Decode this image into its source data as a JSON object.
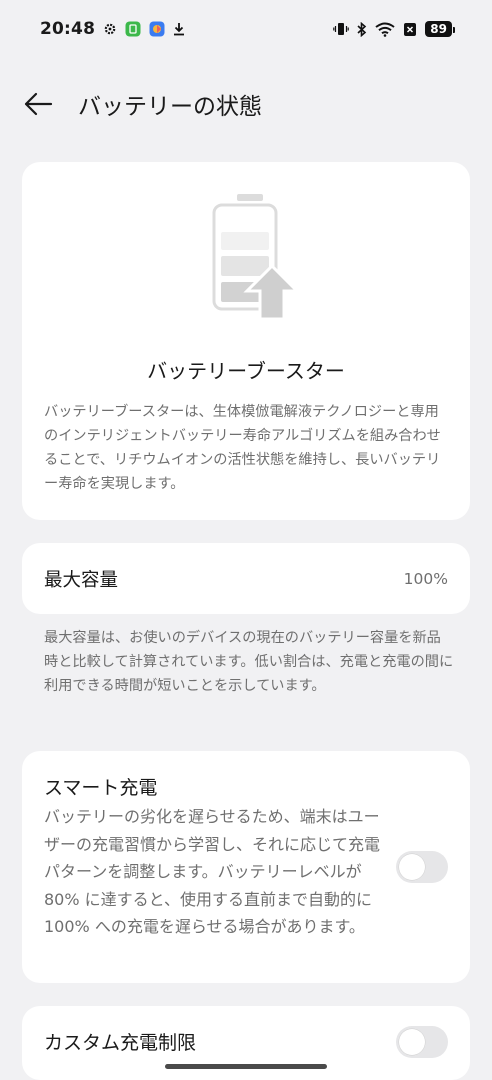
{
  "status_bar": {
    "time": "20:48",
    "battery_level": "89",
    "left_icons": [
      "gear-icon",
      "app-icon-green",
      "app-icon-colorful",
      "download-icon"
    ],
    "right_icons": [
      "vibrate-icon",
      "bluetooth-icon",
      "wifi-icon",
      "no-sim-icon",
      "battery-icon"
    ]
  },
  "header": {
    "title": "バッテリーの状態"
  },
  "booster": {
    "title": "バッテリーブースター",
    "description": "バッテリーブースターは、生体模倣電解液テクノロジーと専用のインテリジェントバッテリー寿命アルゴリズムを組み合わせることで、リチウムイオンの活性状態を維持し、長いバッテリー寿命を実現します。"
  },
  "capacity": {
    "label": "最大容量",
    "value": "100%",
    "description": "最大容量は、お使いのデバイスの現在のバッテリー容量を新品時と比較して計算されています。低い割合は、充電と充電の間に利用できる時間が短いことを示しています。"
  },
  "smart_charging": {
    "title": "スマート充電",
    "description": "バッテリーの劣化を遅らせるため、端末はユーザーの充電習慣から学習し、それに応じて充電パターンを調整します。バッテリーレベルが 80% に達すると、使用する直前まで自動的に 100% への充電を遅らせる場合があります。",
    "enabled": false
  },
  "custom_limit": {
    "label": "カスタム充電制限",
    "enabled": false
  },
  "colors": {
    "background": "#f1f1f3",
    "card": "#ffffff",
    "toggle_off": "#e6e6e8",
    "secondary_text": "#6f6f6f"
  }
}
